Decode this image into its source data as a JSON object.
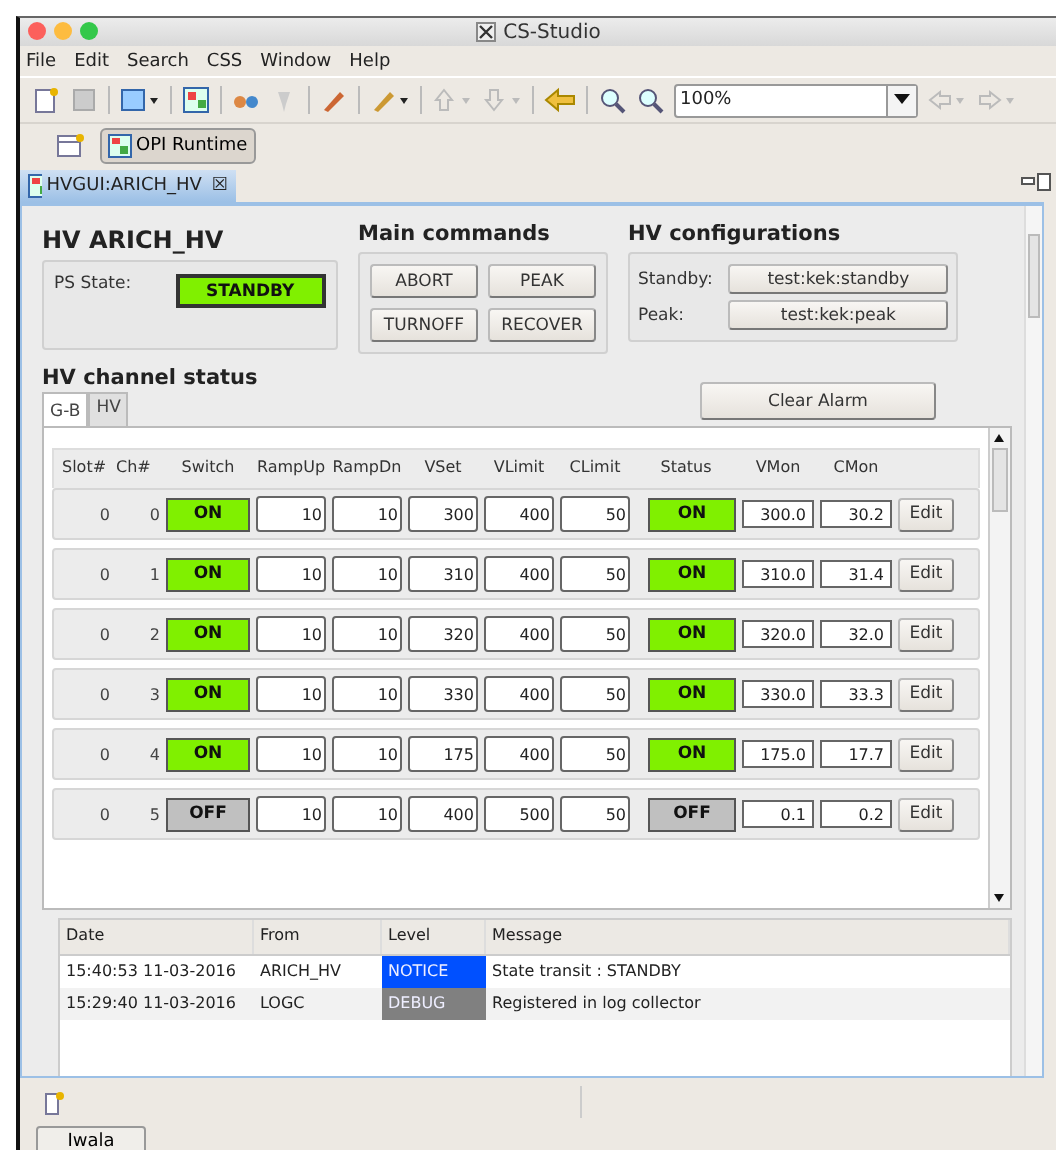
{
  "window": {
    "title": "CS-Studio"
  },
  "menu": [
    "File",
    "Edit",
    "Search",
    "CSS",
    "Window",
    "Help"
  ],
  "toolbar": {
    "zoom": "100%"
  },
  "perspective": {
    "label": "OPI Runtime",
    "selected": true
  },
  "editor_tab": {
    "label": "HVGUI:ARICH_HV",
    "close": "☒"
  },
  "header": {
    "title": "HV ARICH_HV",
    "ps_state_label": "PS State:",
    "ps_state": "STANDBY",
    "ps_state_on": true
  },
  "main_commands": {
    "title": "Main commands",
    "buttons": [
      "ABORT",
      "PEAK",
      "TURNOFF",
      "RECOVER"
    ]
  },
  "hv_configurations": {
    "title": "HV configurations",
    "items": [
      {
        "label": "Standby:",
        "value": "test:kek:standby"
      },
      {
        "label": "Peak:",
        "value": "test:kek:peak"
      }
    ]
  },
  "channel_status": {
    "title": "HV channel status",
    "clear_button": "Clear Alarm",
    "tabs": [
      {
        "label": "G-B",
        "selected": true
      },
      {
        "label": "HV",
        "selected": false
      }
    ],
    "columns": [
      "Slot#",
      "Ch#",
      "Switch",
      "RampUp",
      "RampDn",
      "VSet",
      "VLimit",
      "CLimit",
      "Status",
      "VMon",
      "CMon"
    ],
    "rows": [
      {
        "slot": "0",
        "ch": "0",
        "switch": "ON",
        "switch_on": true,
        "rampup": "10",
        "rampdn": "10",
        "vset": "300",
        "vlimit": "400",
        "climit": "50",
        "status": "ON",
        "status_on": true,
        "vmon": "300.0",
        "cmon": "30.2",
        "edit": "Edit"
      },
      {
        "slot": "0",
        "ch": "1",
        "switch": "ON",
        "switch_on": true,
        "rampup": "10",
        "rampdn": "10",
        "vset": "310",
        "vlimit": "400",
        "climit": "50",
        "status": "ON",
        "status_on": true,
        "vmon": "310.0",
        "cmon": "31.4",
        "edit": "Edit"
      },
      {
        "slot": "0",
        "ch": "2",
        "switch": "ON",
        "switch_on": true,
        "rampup": "10",
        "rampdn": "10",
        "vset": "320",
        "vlimit": "400",
        "climit": "50",
        "status": "ON",
        "status_on": true,
        "vmon": "320.0",
        "cmon": "32.0",
        "edit": "Edit"
      },
      {
        "slot": "0",
        "ch": "3",
        "switch": "ON",
        "switch_on": true,
        "rampup": "10",
        "rampdn": "10",
        "vset": "330",
        "vlimit": "400",
        "climit": "50",
        "status": "ON",
        "status_on": true,
        "vmon": "330.0",
        "cmon": "33.3",
        "edit": "Edit"
      },
      {
        "slot": "0",
        "ch": "4",
        "switch": "ON",
        "switch_on": true,
        "rampup": "10",
        "rampdn": "10",
        "vset": "175",
        "vlimit": "400",
        "climit": "50",
        "status": "ON",
        "status_on": true,
        "vmon": "175.0",
        "cmon": "17.7",
        "edit": "Edit"
      },
      {
        "slot": "0",
        "ch": "5",
        "switch": "OFF",
        "switch_on": false,
        "rampup": "10",
        "rampdn": "10",
        "vset": "400",
        "vlimit": "500",
        "climit": "50",
        "status": "OFF",
        "status_on": false,
        "vmon": "0.1",
        "cmon": "0.2",
        "edit": "Edit"
      }
    ]
  },
  "log": {
    "columns": [
      "Date",
      "From",
      "Level",
      "Message"
    ],
    "rows": [
      {
        "date": "15:40:53 11-03-2016",
        "from": "ARICH_HV",
        "level": "NOTICE",
        "color": "#0050ff",
        "message": "State transit : STANDBY"
      },
      {
        "date": "15:29:40 11-03-2016",
        "from": "LOGC",
        "level": "DEBUG",
        "color": "#808080",
        "message": "Registered in log collector"
      }
    ]
  },
  "taskbar": {
    "button": "Iwala"
  }
}
